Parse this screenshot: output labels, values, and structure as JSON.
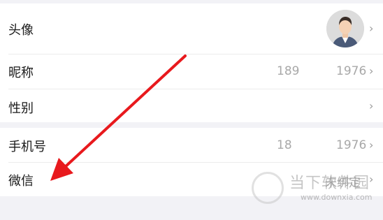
{
  "rows": {
    "avatar": {
      "label": "头像",
      "chevron": "›"
    },
    "nickname": {
      "label": "昵称",
      "value_part1": "189",
      "value_part2": "1976",
      "chevron": "›"
    },
    "gender": {
      "label": "性别",
      "chevron": "›"
    },
    "phone": {
      "label": "手机号",
      "value_part1": "18",
      "value_part2": "1976",
      "chevron": "›"
    },
    "wechat": {
      "label": "微信",
      "value": "未绑定",
      "chevron": "›"
    }
  },
  "watermark": {
    "title": "当下软件园",
    "url": "www.downxia.com"
  },
  "colors": {
    "annotation_arrow": "#e8191d",
    "background": "#f2f2f6",
    "row_bg": "#ffffff"
  }
}
